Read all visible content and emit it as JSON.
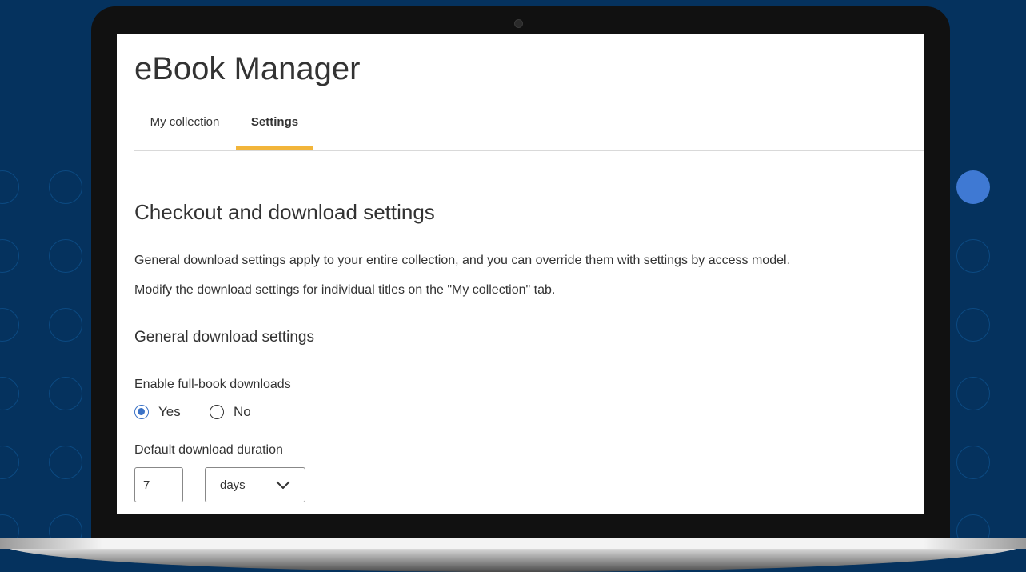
{
  "app": {
    "title": "eBook Manager"
  },
  "tabs": [
    {
      "label": "My collection",
      "active": false
    },
    {
      "label": "Settings",
      "active": true
    }
  ],
  "main": {
    "section_title": "Checkout and download settings",
    "description_1": "General download settings apply to your entire collection, and you can override them with settings by access model.",
    "description_2": "Modify the download settings for individual titles on the \"My collection\" tab.",
    "subsection_title": "General download settings",
    "full_book": {
      "label": "Enable full-book downloads",
      "options": [
        {
          "label": "Yes",
          "checked": true
        },
        {
          "label": "No",
          "checked": false
        }
      ]
    },
    "duration": {
      "label": "Default download duration",
      "value": "7",
      "unit": "days",
      "unit_icon": "chevron-down-icon"
    }
  },
  "colors": {
    "background": "#05325e",
    "accent_tab": "#f2b53a",
    "radio_selected": "#3b72c6",
    "decor_dot": "#3f79d3"
  }
}
